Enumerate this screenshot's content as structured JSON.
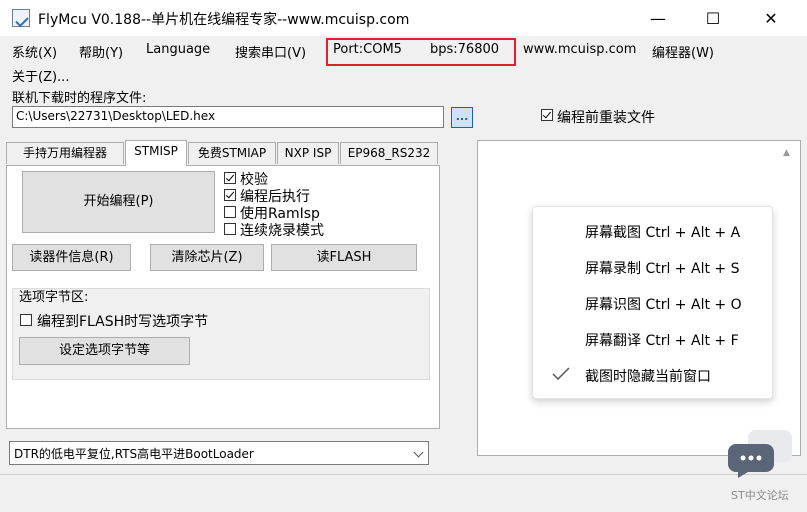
{
  "window": {
    "title": "FlyMcu V0.188--单片机在线编程专家--www.mcuisp.com",
    "minimize_glyph": "—",
    "maximize_glyph": "☐",
    "close_glyph": "✕"
  },
  "menu": {
    "items": [
      "系统(X)",
      "帮助(Y)",
      "Language",
      "搜索串口(V)",
      "Port:COM5",
      "bps:76800",
      "www.mcuisp.com",
      "编程器(W)",
      "关于(Z)..."
    ]
  },
  "file": {
    "label": "联机下载时的程序文件:",
    "path": "C:\\Users\\22731\\Desktop\\LED.hex",
    "browse_label": "...",
    "reload_label": "编程前重装文件",
    "reload_checked": true
  },
  "tabs": [
    "手持万用编程器",
    "STMISP",
    "免费STMIAP",
    "NXP ISP",
    "EP968_RS232"
  ],
  "active_tab": "STMISP",
  "stmisp": {
    "start_button": "开始编程(P)",
    "options": [
      {
        "label": "校验",
        "checked": true
      },
      {
        "label": "编程后执行",
        "checked": true
      },
      {
        "label": "使用RamIsp",
        "checked": false
      },
      {
        "label": "连续烧录模式",
        "checked": false
      }
    ],
    "read_info_button": "读器件信息(R)",
    "erase_button": "清除芯片(Z)",
    "read_flash_button": "读FLASH",
    "option_group": {
      "title": "选项字节区:",
      "write_checkbox": "编程到FLASH时写选项字节",
      "write_checked": false,
      "set_button": "设定选项字节等"
    }
  },
  "reset_mode": {
    "selected": "DTR的低电平复位,RTS高电平进BootLoader"
  },
  "context_menu": {
    "items": [
      "屏幕截图 Ctrl + Alt + A",
      "屏幕录制 Ctrl + Alt + S",
      "屏幕识图 Ctrl + Alt + O",
      "屏幕翻译 Ctrl + Alt + F",
      "截图时隐藏当前窗口"
    ],
    "checked_item": "截图时隐藏当前窗口"
  },
  "watermark": {
    "text": "ST中文论坛"
  },
  "colors": {
    "highlight_box": "#e0202c",
    "browse_button": "#cfe3f8"
  }
}
